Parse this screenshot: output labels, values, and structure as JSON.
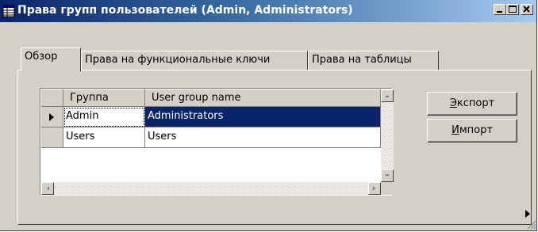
{
  "window": {
    "title": "Права групп пользователей (Admin, Administrators)",
    "titlebar_color": "#0a246a",
    "face_color": "#d4d0c8"
  },
  "controls": {
    "minimize_label": "_",
    "maximize_label": "□",
    "close_label": "X"
  },
  "tabs": [
    {
      "label": "Обзор",
      "active": true
    },
    {
      "label": "Права на функциональные ключи",
      "active": false
    },
    {
      "label": "Права на таблицы",
      "active": false
    }
  ],
  "grid": {
    "columns": [
      "Группа",
      "User group name"
    ],
    "rows": [
      {
        "group": "Admin",
        "name": "Administrators",
        "selected": true,
        "current": true
      },
      {
        "group": "Users",
        "name": "Users",
        "selected": false,
        "current": false
      }
    ],
    "selection_color": "#0a246a"
  },
  "buttons": {
    "export": {
      "accel": "Э",
      "rest": "кспорт"
    },
    "import": {
      "accel": "И",
      "rest": "мпорт"
    }
  },
  "icons": {
    "app": "table-icon",
    "row_indicator": "triangle-right-icon",
    "scroll_up": "arrow-up-icon",
    "scroll_down": "arrow-down-icon",
    "scroll_left": "arrow-left-icon",
    "scroll_right": "arrow-right-icon",
    "status": "triangle-right-icon",
    "resize": "size-grip-icon"
  }
}
